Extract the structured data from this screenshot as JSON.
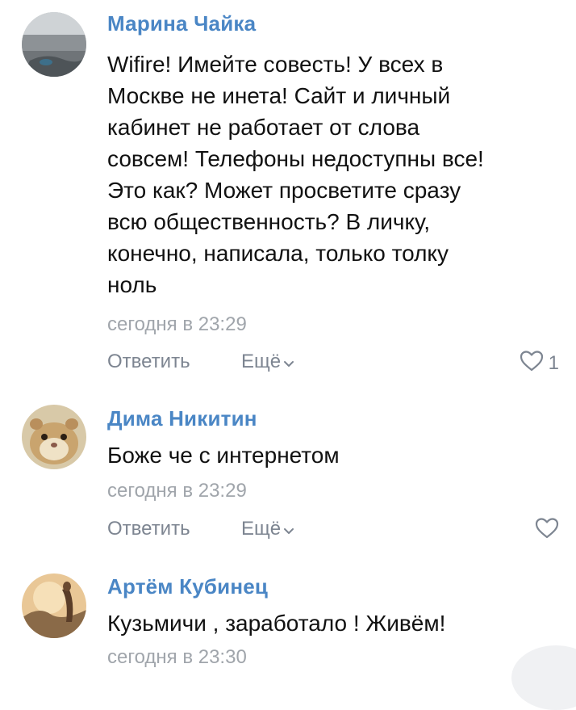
{
  "comments": [
    {
      "author": "Марина Чайка",
      "text_lines": [
        "Wifire! Имейте совесть! У всех в",
        "Москве не инета! Сайт и личный",
        "кабинет не работает от слова",
        "совсем! Телефоны недоступны все!",
        "Это как? Может просветите сразу",
        "всю общественность? В личку,",
        "конечно, написала, только толку",
        "ноль"
      ],
      "time": "сегодня в 23:29",
      "reply_label": "Ответить",
      "more_label": "Ещё",
      "likes": "1"
    },
    {
      "author": "Дима Никитин",
      "text_lines": [
        "Боже че с интернетом"
      ],
      "time": "сегодня в 23:29",
      "reply_label": "Ответить",
      "more_label": "Ещё"
    },
    {
      "author": "Артём Кубинец",
      "text_lines": [
        "Кузьмичи , заработало ! Живём!"
      ],
      "time": "сегодня в 23:30"
    }
  ],
  "icons": {
    "like": "heart-outline-icon",
    "more": "chevron-down-icon"
  },
  "colors": {
    "author": "#4a86c5",
    "meta": "#a0a5ab",
    "action": "#7d8591"
  }
}
